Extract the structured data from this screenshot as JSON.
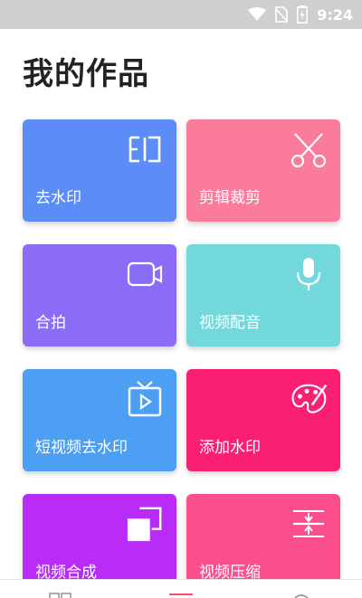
{
  "status_bar": {
    "time": "9:24",
    "icons": [
      "wifi-icon",
      "no-sim-icon",
      "battery-charging-icon"
    ]
  },
  "page": {
    "title": "我的作品"
  },
  "cards": [
    {
      "label": "去水印",
      "icon": "watermark-icon",
      "color": "#5b8cf7"
    },
    {
      "label": "剪辑裁剪",
      "icon": "scissors-icon",
      "color": "#fb7b9c"
    },
    {
      "label": "合拍",
      "icon": "camera-icon",
      "color": "#8b6cf7"
    },
    {
      "label": "视频配音",
      "icon": "microphone-icon",
      "color": "#72d8dc"
    },
    {
      "label": "短视频去水印",
      "icon": "tv-play-icon",
      "color": "#4c9ff3"
    },
    {
      "label": "添加水印",
      "icon": "palette-icon",
      "color": "#fb1f73"
    },
    {
      "label": "视频合成",
      "icon": "merge-squares-icon",
      "color": "#b92cf7"
    },
    {
      "label": "视频压缩",
      "icon": "compress-icon",
      "color": "#fb4f8d"
    }
  ],
  "bottom_nav": {
    "items": [
      "grid-icon",
      "list-icon",
      "search-icon"
    ],
    "accent": "#fb4f6d"
  }
}
